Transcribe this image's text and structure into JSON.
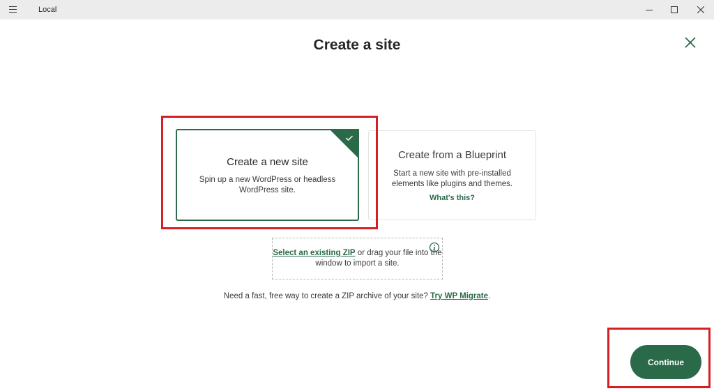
{
  "window": {
    "app_name": "Local",
    "controls": {
      "minimize_icon": "minimize-icon",
      "maximize_icon": "maximize-icon",
      "close_icon": "close-icon"
    }
  },
  "header": {
    "title": "Create a site",
    "close_icon": "close-x-icon"
  },
  "options": {
    "new_site": {
      "title": "Create a new site",
      "description": "Spin up a new WordPress or headless WordPress site.",
      "selected": true
    },
    "blueprint": {
      "title": "Create from a Blueprint",
      "description": "Start a new site with pre-installed elements like plugins and themes.",
      "link": "What's this?"
    }
  },
  "zip": {
    "link": "Select an existing ZIP",
    "text": "or drag your file into the window to import a site.",
    "info_icon": "info-icon"
  },
  "help": {
    "text": "Need a fast, free way to create a ZIP archive of your site?",
    "link": "Try WP Migrate",
    "suffix": "."
  },
  "footer": {
    "continue_label": "Continue"
  },
  "colors": {
    "accent": "#2a6a49",
    "annotation": "#d41f25",
    "titlebar": "#ececec"
  }
}
